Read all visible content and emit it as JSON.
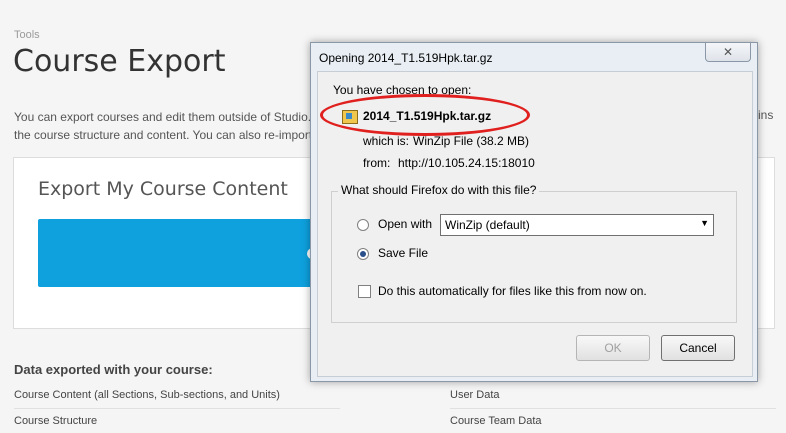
{
  "page": {
    "breadcrumb": "Tools",
    "title": "Course Export",
    "intro_line1": "You can export courses and edit them outside of Studio.",
    "intro_line2": "the course structure and content. You can also re-import",
    "intro_right": "ins",
    "export_card_title": "Export My Course Content",
    "data_heading_bold": "Data exported with your course:",
    "left_list": [
      "Course Content (all Sections, Sub-sections, and Units)",
      "Course Structure"
    ],
    "right_list": [
      "User Data",
      "Course Team Data"
    ]
  },
  "dialog": {
    "title": "Opening 2014_T1.519Hpk.tar.gz",
    "close_glyph": "✕",
    "chosen_label": "You have chosen to open:",
    "file_name": "2014_T1.519Hpk.tar.gz",
    "which_is_label": "which is:",
    "which_is_value": "WinZip File (38.2 MB)",
    "from_label": "from:",
    "from_value": "http://10.105.24.15:18010",
    "group_legend": "What should Firefox do with this file?",
    "open_with_label": "Open with",
    "open_with_selected": "WinZip (default)",
    "save_file_label": "Save File",
    "auto_label": "Do this automatically for files like this from now on.",
    "ok_label": "OK",
    "cancel_label": "Cancel",
    "highlight_color": "#e0201e"
  }
}
